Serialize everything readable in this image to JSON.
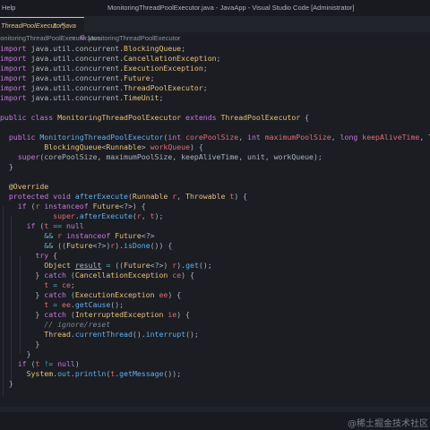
{
  "titlebar": {
    "menu_fragment": "Help",
    "window_title": "MonitoringThreadPoolExecutor.java - JavaApp - Visual Studio Code [Administrator]"
  },
  "tab": {
    "label": "ThreadPoolExecutor.java",
    "problem_count": "1",
    "close_glyph": "×"
  },
  "breadcrumb": {
    "file": "MonitoringThreadPoolExecutor.java",
    "separator": ">",
    "symbol_icon": "class-icon",
    "symbol": "MonitoringThreadPoolExecutor"
  },
  "watermark": "@稀土掘金技术社区",
  "colors": {
    "background": "#1b1d23",
    "keyword": "#c678dd",
    "type": "#e5c07b",
    "function": "#61afef",
    "variable": "#e06c75",
    "comment": "#7f848e",
    "operator": "#56b6c2",
    "plain": "#abb2bf"
  }
}
